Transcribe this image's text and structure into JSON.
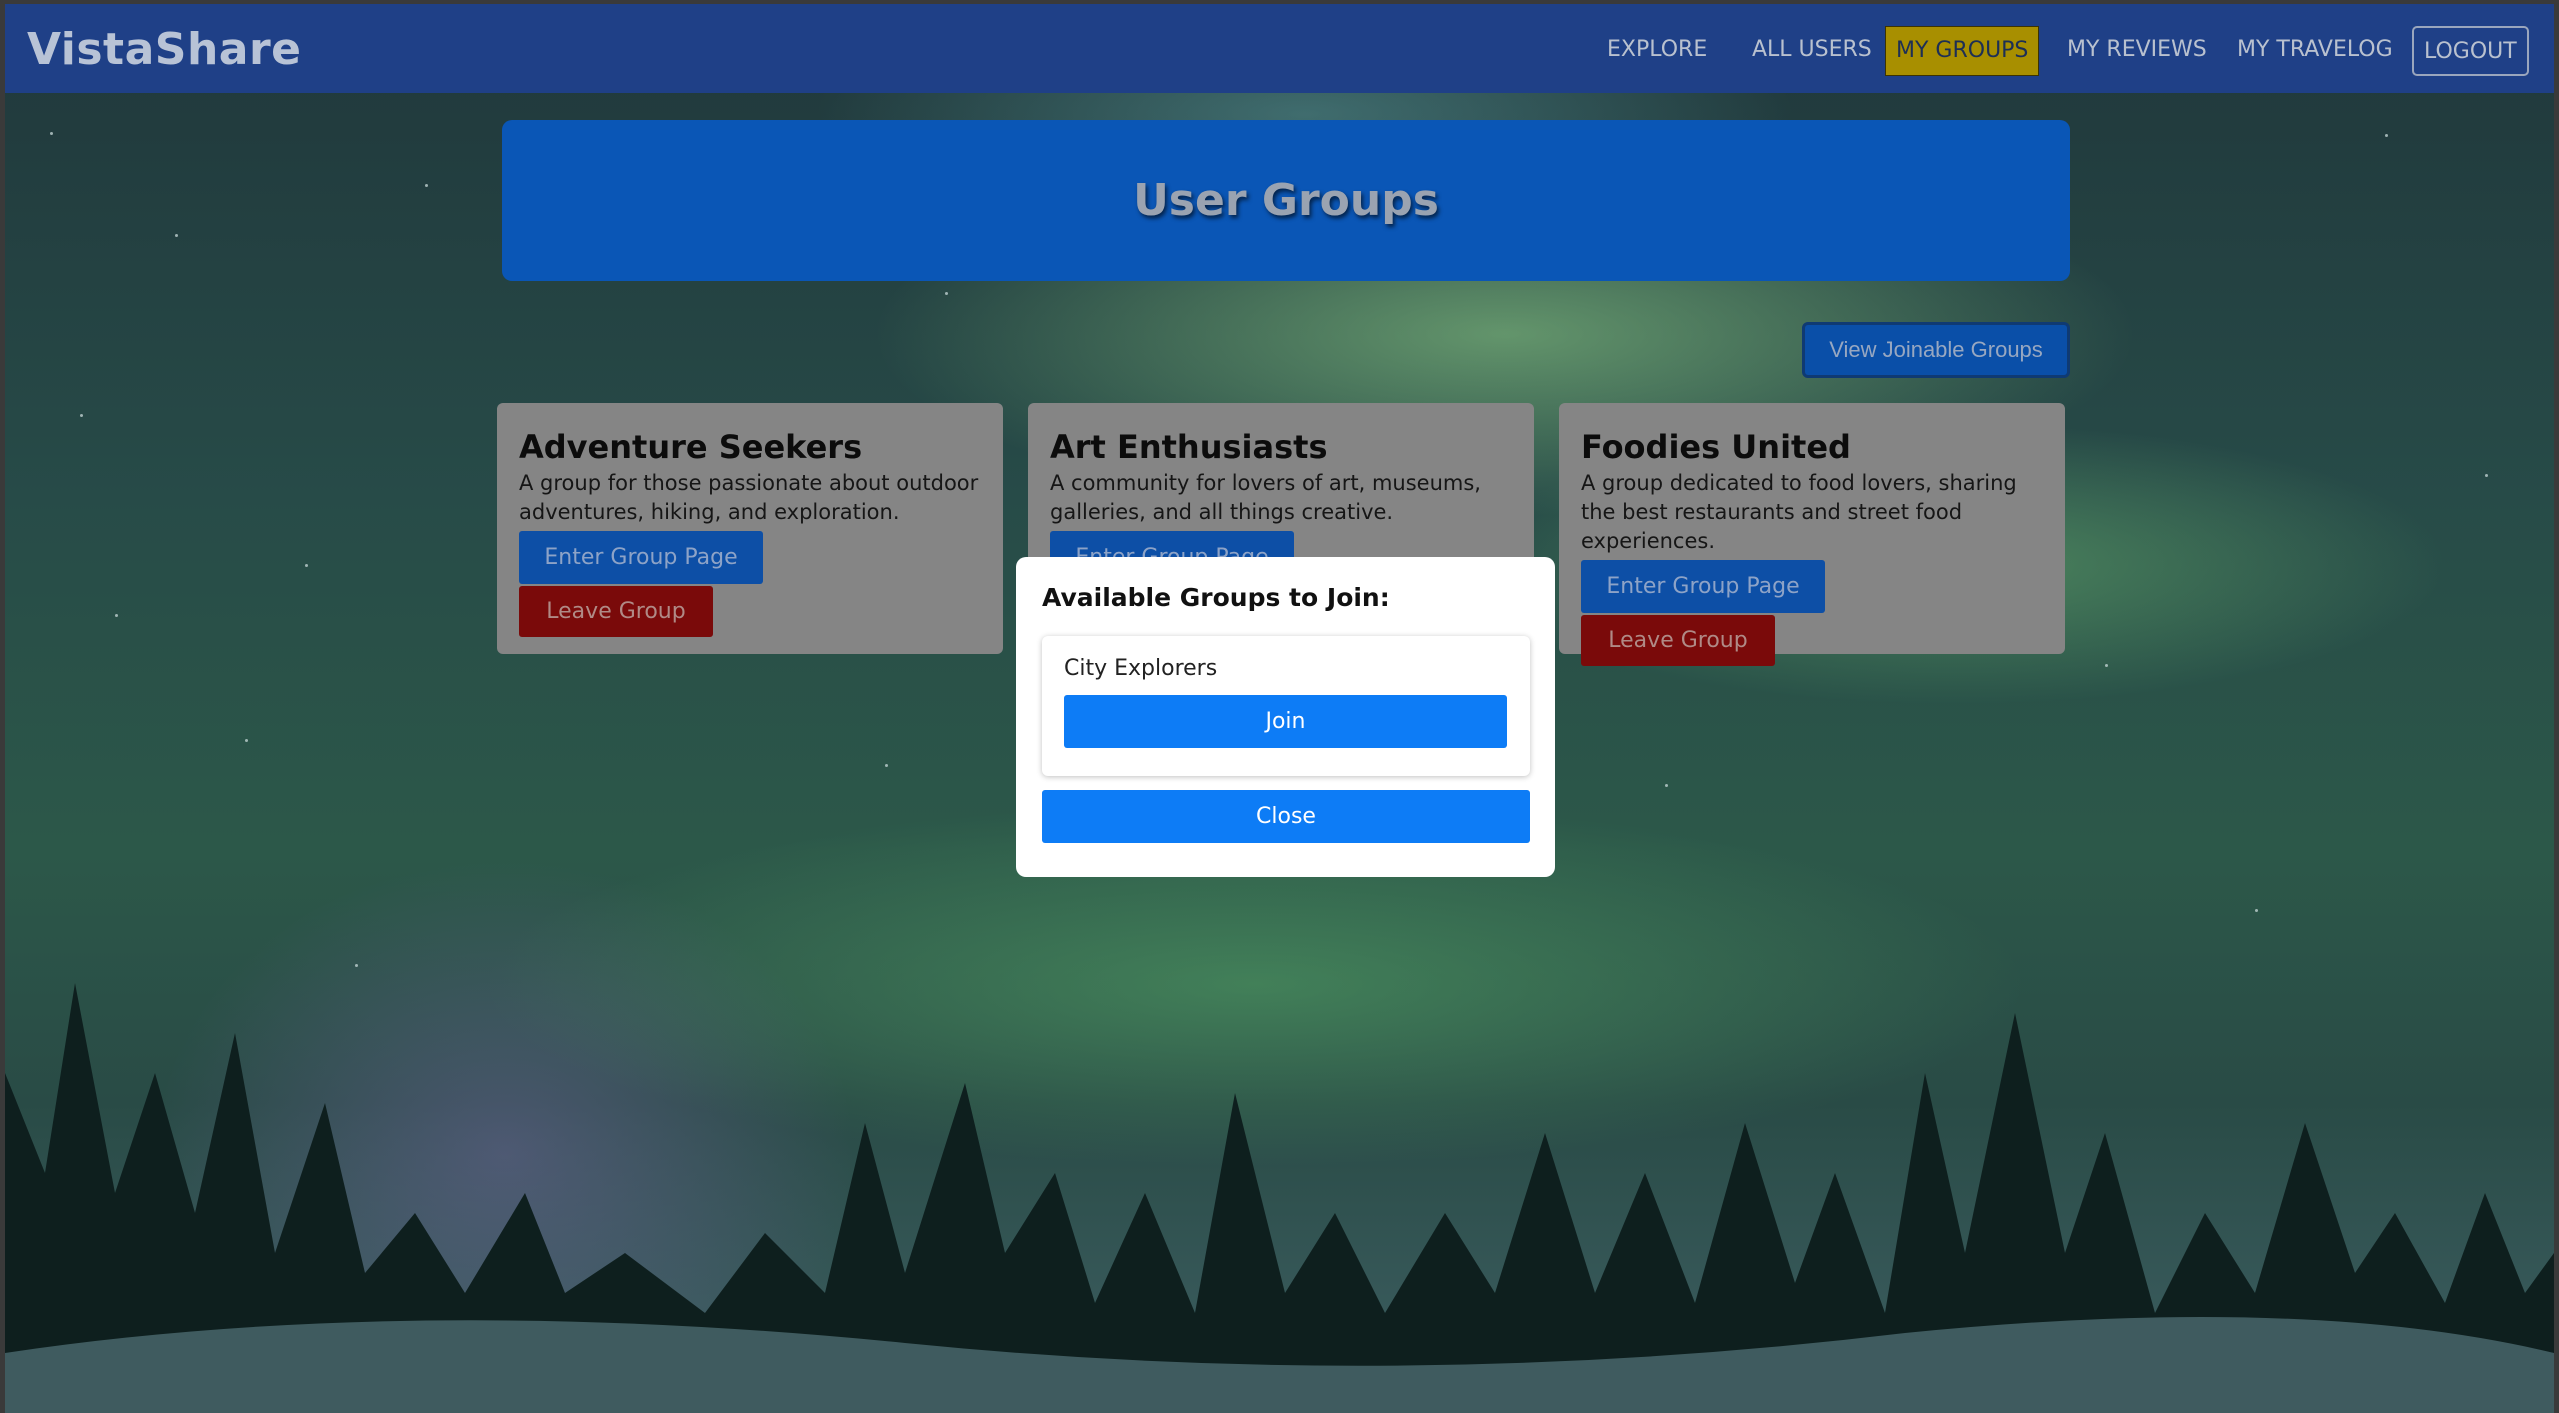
{
  "navbar": {
    "brand": "VistaShare",
    "items": [
      {
        "label": "EXPLORE"
      },
      {
        "label": "ALL USERS"
      },
      {
        "label": "MY GROUPS"
      },
      {
        "label": "MY REVIEWS"
      },
      {
        "label": "MY TRAVELOG"
      },
      {
        "label": "LOGOUT"
      }
    ]
  },
  "page": {
    "title": "User Groups",
    "view_joinable_label": "View Joinable Groups"
  },
  "groups": [
    {
      "name": "Adventure Seekers",
      "description": "A group for those passionate about outdoor adventures, hiking, and exploration.",
      "enter_label": "Enter Group Page",
      "leave_label": "Leave Group"
    },
    {
      "name": "Art Enthusiasts",
      "description": "A community for lovers of art, museums, galleries, and all things creative.",
      "enter_label": "Enter Group Page"
    },
    {
      "name": "Foodies United",
      "description": "A group dedicated to food lovers, sharing the best restaurants and street food experiences.",
      "enter_label": "Enter Group Page",
      "leave_label": "Leave Group"
    }
  ],
  "modal": {
    "title": "Available Groups to Join:",
    "groups": [
      {
        "name": "City Explorers",
        "join_label": "Join"
      }
    ],
    "close_label": "Close"
  },
  "colors": {
    "navbar": "#1f4087",
    "active_nav": "#a88f00",
    "primary_button": "#0d7cf6",
    "leave_button": "#7a0a0a"
  }
}
